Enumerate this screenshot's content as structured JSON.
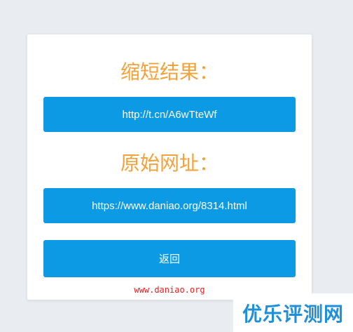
{
  "card": {
    "short_heading": "缩短结果：",
    "short_url": "http://t.cn/A6wTteWf",
    "original_heading": "原始网址：",
    "original_url": "https://www.daniao.org/8314.html",
    "back_label": "返回",
    "watermark": "www.daniao.org"
  },
  "logo": {
    "text": "优乐评测网"
  },
  "colors": {
    "accent": "#0d9ae4",
    "heading": "#f2a23a",
    "watermark": "#e02020",
    "logo": "#1f8fd8",
    "background": "#e9edf1"
  }
}
